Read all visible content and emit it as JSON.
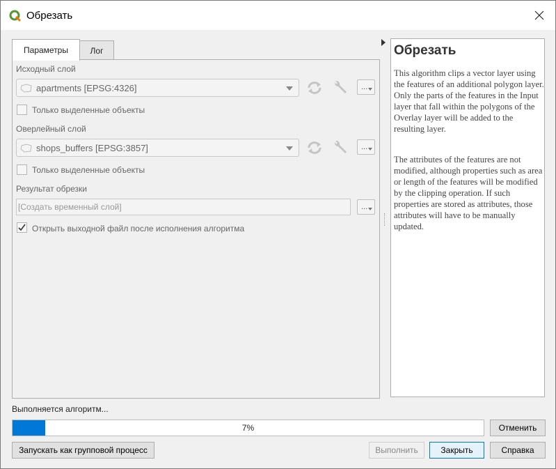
{
  "window": {
    "title": "Обрезать"
  },
  "tabs": [
    {
      "label": "Параметры",
      "active": true
    },
    {
      "label": "Лог",
      "active": false
    }
  ],
  "params": {
    "input_layer_label": "Исходный слой",
    "input_layer_value": "apartments [EPSG:4326]",
    "input_selected_only": "Только выделенные объекты",
    "overlay_layer_label": "Оверлейный слой",
    "overlay_layer_value": "shops_buffers [EPSG:3857]",
    "overlay_selected_only": "Только выделенные объекты",
    "output_label": "Результат обрезки",
    "output_placeholder": "[Создать временный слой]",
    "open_output": "Открыть выходной файл после исполнения алгоритма",
    "open_output_checked": true,
    "dots": "..."
  },
  "help": {
    "title": "Обрезать",
    "p1": "This algorithm clips a vector layer using the features of an additional polygon layer. Only the parts of the features in the Input layer that fall within the polygons of the Overlay layer will be added to the resulting layer.",
    "p2": "The attributes of the features are not modified, although properties such as area or length of the features will be modified by the clipping operation. If such properties are stored as attributes, those attributes will have to be manually updated."
  },
  "status": {
    "text": "Выполняется алгоритм...",
    "progress_percent": 7,
    "progress_label": "7%"
  },
  "buttons": {
    "cancel": "Отменить",
    "batch": "Запускать как групповой процесс",
    "run": "Выполнить",
    "close": "Закрыть",
    "help": "Справка"
  },
  "colors": {
    "accent": "#0078d7",
    "qgis_green": "#589632",
    "qgis_yellow": "#ee7913"
  }
}
